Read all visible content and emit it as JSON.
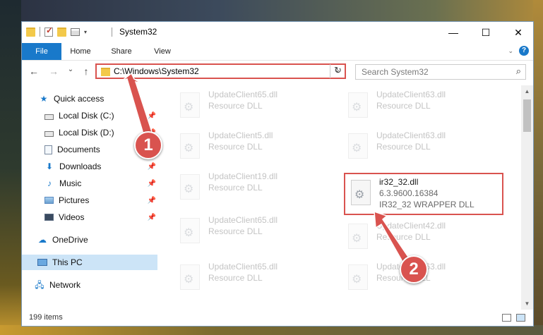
{
  "window": {
    "title": "System32",
    "controls": {
      "minimize": "—",
      "maximize": "☐",
      "close": "✕"
    }
  },
  "ribbon": {
    "tabs": [
      "File",
      "Home",
      "Share",
      "View"
    ],
    "help": "?"
  },
  "nav": {
    "back": "←",
    "forward": "→",
    "recent": "⌄",
    "up": "↑"
  },
  "address": {
    "path": "C:\\Windows\\System32",
    "refresh": "↻"
  },
  "search": {
    "placeholder": "Search System32",
    "icon": "⌕"
  },
  "sidebar": {
    "items": [
      {
        "label": "Quick access",
        "icon": "star-icon",
        "pinned": false
      },
      {
        "label": "Local Disk (C:)",
        "icon": "disk-icon",
        "pinned": true
      },
      {
        "label": "Local Disk (D:)",
        "icon": "disk-icon",
        "pinned": true
      },
      {
        "label": "Documents",
        "icon": "documents-icon",
        "pinned": true
      },
      {
        "label": "Downloads",
        "icon": "download-icon",
        "pinned": true
      },
      {
        "label": "Music",
        "icon": "music-icon",
        "pinned": true
      },
      {
        "label": "Pictures",
        "icon": "pictures-icon",
        "pinned": true
      },
      {
        "label": "Videos",
        "icon": "videos-icon",
        "pinned": true
      },
      {
        "label": "OneDrive",
        "icon": "cloud-icon",
        "pinned": false
      },
      {
        "label": "This PC",
        "icon": "pc-icon",
        "pinned": false
      },
      {
        "label": "Network",
        "icon": "network-icon",
        "pinned": false
      }
    ]
  },
  "files": [
    {
      "name": "UpdateClient65.dll",
      "desc": "Resource DLL"
    },
    {
      "name": "UpdateClient63.dll",
      "desc": "Resource DLL"
    },
    {
      "name": "UpdateClient5.dll",
      "desc": "Resource DLL"
    },
    {
      "name": "UpdateClient63.dll",
      "desc": "Resource DLL"
    },
    {
      "name": "UpdateClient19.dll",
      "desc": "Resource DLL"
    },
    {
      "name": "ir32_32.dll",
      "version": "6.3.9600.16384",
      "desc": "IR32_32 WRAPPER DLL"
    },
    {
      "name": "UpdateClient65.dll",
      "desc": "Resource DLL"
    },
    {
      "name": "UpdateClient42.dll",
      "desc": "Resource DLL"
    },
    {
      "name": "UpdateClient65.dll",
      "desc": "Resource DLL"
    },
    {
      "name": "UpdateClient63.dll",
      "desc": "Resource DLL"
    }
  ],
  "status": {
    "count": "199 items"
  },
  "callouts": {
    "one": "1",
    "two": "2"
  },
  "colors": {
    "accent": "#1979ca",
    "highlight": "#d9534f"
  }
}
